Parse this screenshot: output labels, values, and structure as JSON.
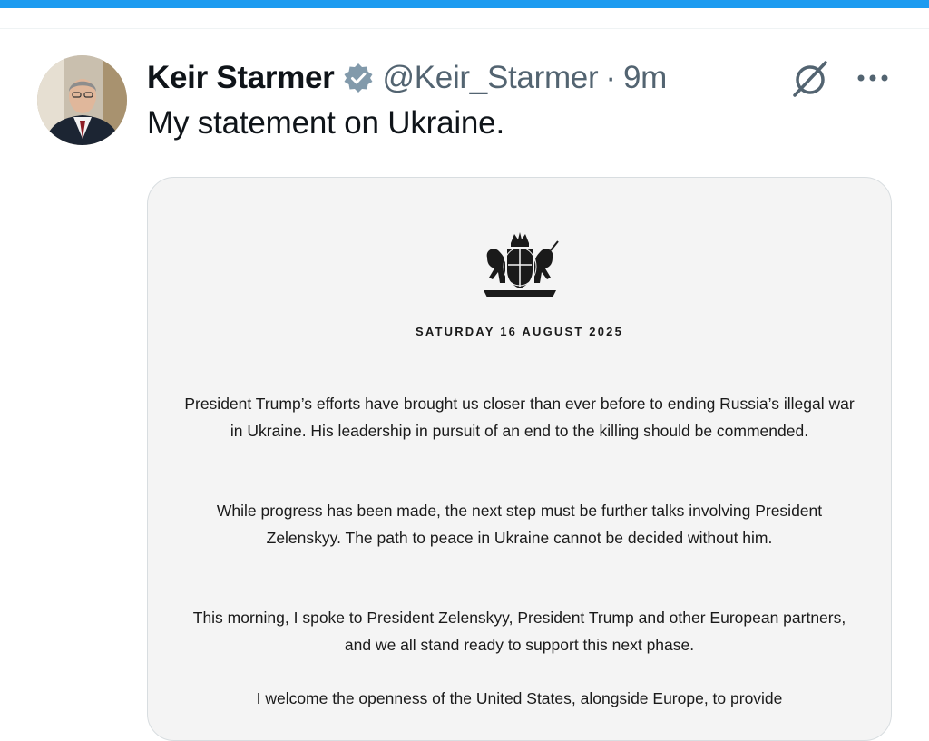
{
  "tweet": {
    "author_name": "Keir Starmer",
    "handle": "@Keir_Starmer",
    "separator": "·",
    "time": "9m",
    "text": "My statement on Ukraine."
  },
  "icons": {
    "verified": "verified-badge-icon",
    "grok": "grok-icon",
    "more": "more-options-icon"
  },
  "colors": {
    "accent": "#1d9bf0",
    "verified": "#829aab",
    "secondary_text": "#536471"
  },
  "statement": {
    "date": "SATURDAY 16 AUGUST 2025",
    "paragraphs": [
      "President Trump’s efforts have brought us closer than ever before to ending Russia’s illegal war in Ukraine. His leadership in pursuit of an end to the killing should be commended.",
      "While progress has been made, the next step must be further talks involving President Zelenskyy. The path to peace in Ukraine cannot be decided without him.",
      "This morning, I spoke to President Zelenskyy, President Trump and other European partners, and we all stand ready to support this next phase.",
      "I welcome the openness of the United States, alongside Europe, to provide"
    ]
  }
}
